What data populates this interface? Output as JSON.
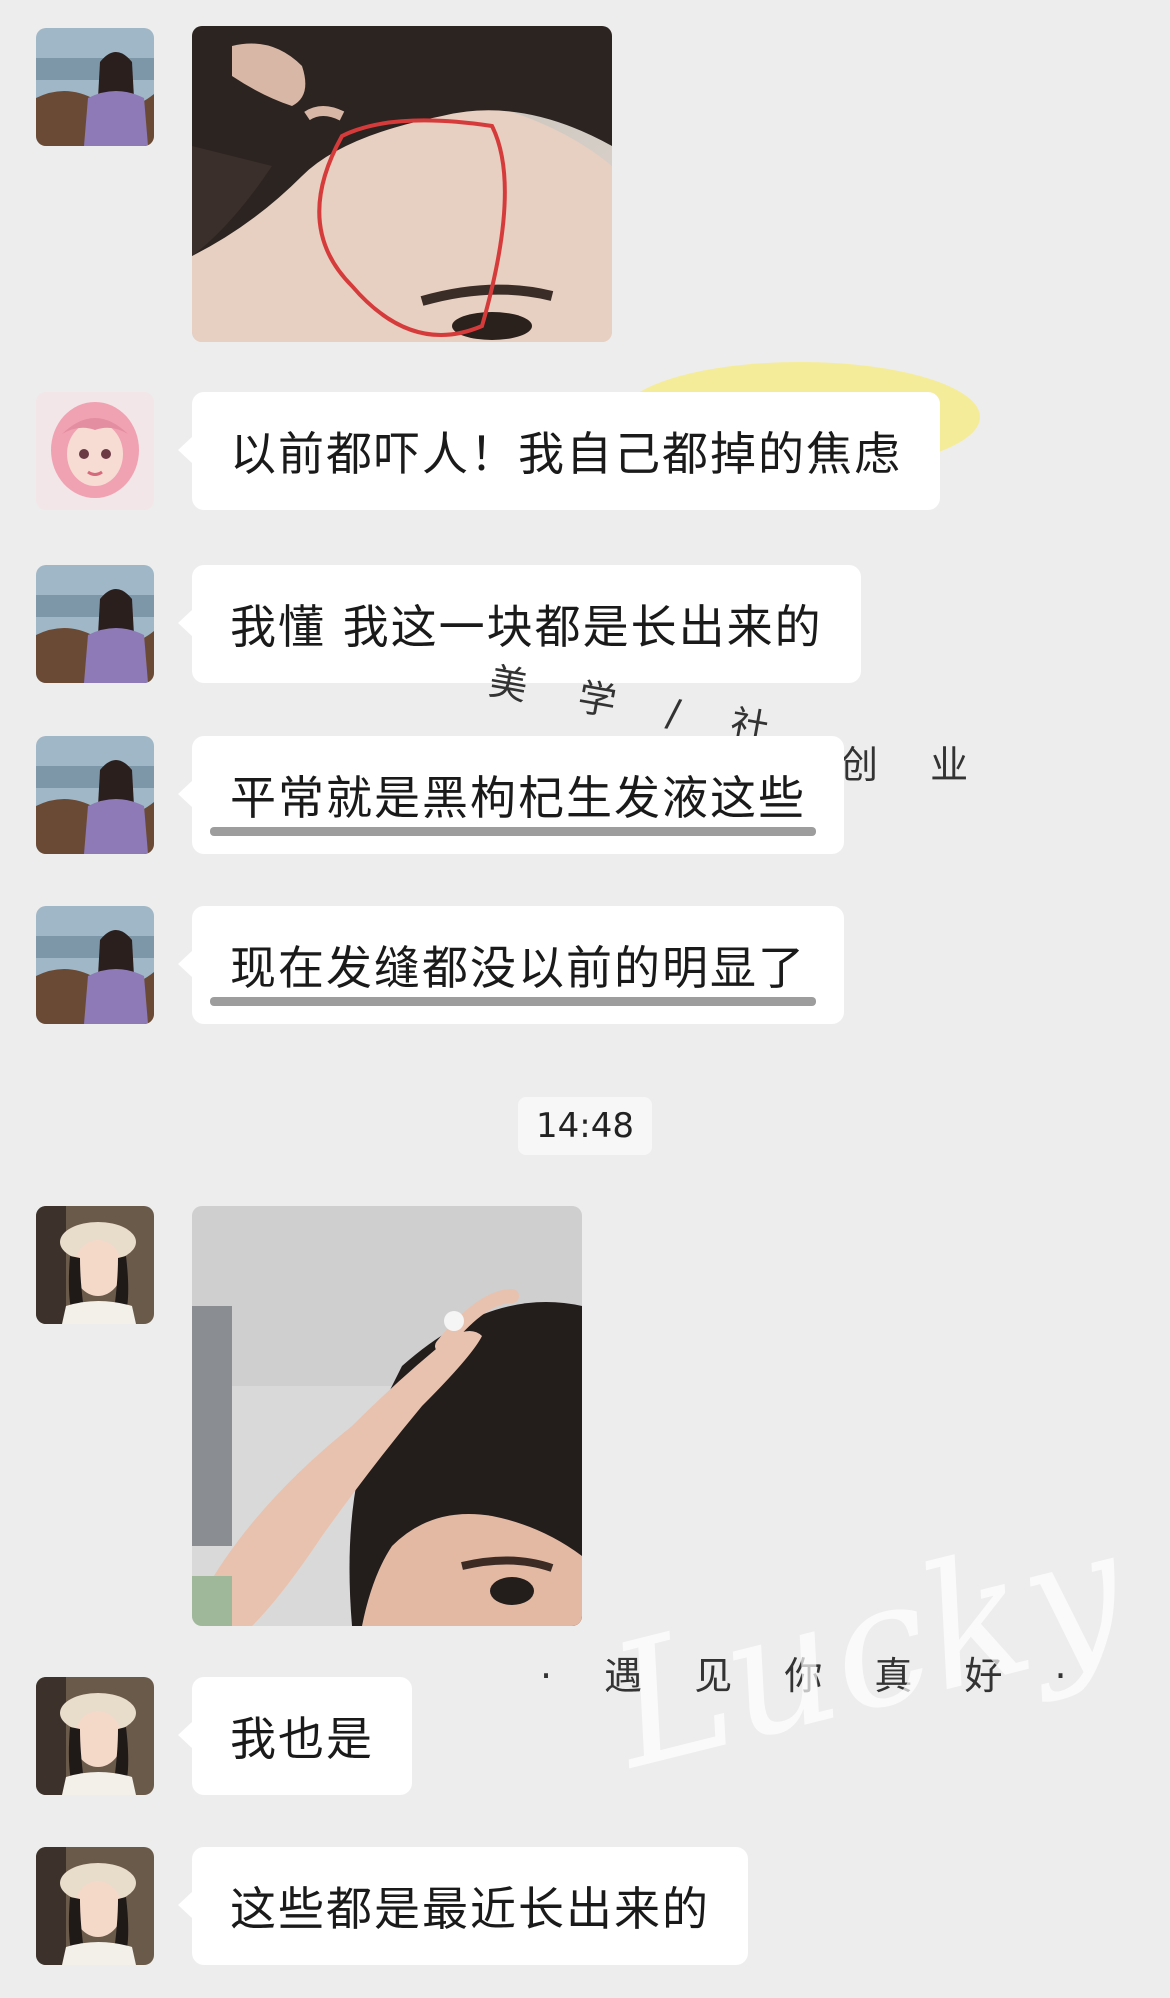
{
  "messages": [
    {
      "sender": "landscape-avatar",
      "type": "image",
      "image_desc": "forehead hairline with red circle"
    },
    {
      "sender": "pink-hair-avatar",
      "type": "text",
      "text": "以前都吓人！我自己都掉的焦虑"
    },
    {
      "sender": "landscape-avatar",
      "type": "text",
      "text": "我懂 我这一块都是长出来的"
    },
    {
      "sender": "landscape-avatar",
      "type": "text",
      "text": "平常就是黑枸杞生发液这些",
      "underlined": true
    },
    {
      "sender": "landscape-avatar",
      "type": "text",
      "text": "现在发缝都没以前的明显了",
      "underlined": true
    },
    {
      "sender": "beret-avatar",
      "type": "image",
      "image_desc": "hand on hairline selfie"
    },
    {
      "sender": "beret-avatar",
      "type": "text",
      "text": "我也是"
    },
    {
      "sender": "beret-avatar",
      "type": "text",
      "text": "这些都是最近长出来的"
    }
  ],
  "timestamp": "14:48",
  "decorations": {
    "sticker_line_1": "美 学 / 社",
    "sticker_line_2": "创 业",
    "sticker_line_3": "· 遇 见 你 真 好 ·",
    "script_word": "Lucky",
    "blob_color": "#f5ec9a"
  },
  "colors": {
    "background": "#ededed",
    "bubble": "#ffffff",
    "text": "#1a1a1a",
    "underline": "#8c8c8c"
  }
}
